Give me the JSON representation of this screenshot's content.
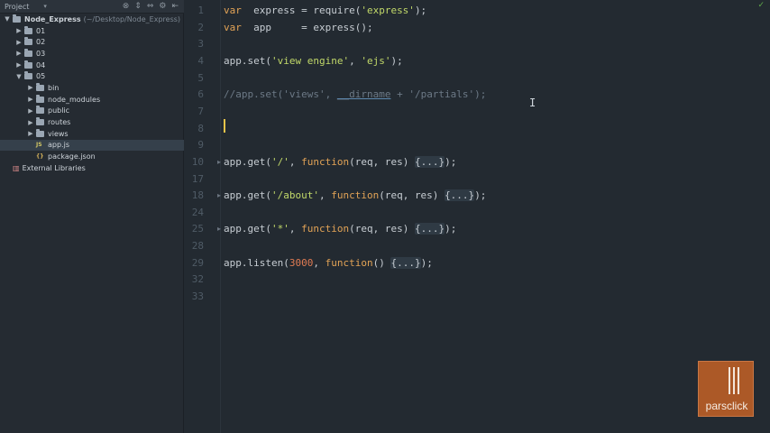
{
  "sidebar": {
    "header": {
      "label": "Project"
    },
    "tree": [
      {
        "label": "Node_Express",
        "hint": "(~/Desktop/Node_Express)",
        "depth": 0,
        "type": "folder",
        "expanded": true
      },
      {
        "label": "01",
        "depth": 1,
        "type": "folder",
        "expanded": false
      },
      {
        "label": "02",
        "depth": 1,
        "type": "folder",
        "expanded": false
      },
      {
        "label": "03",
        "depth": 1,
        "type": "folder",
        "expanded": false
      },
      {
        "label": "04",
        "depth": 1,
        "type": "folder",
        "expanded": false
      },
      {
        "label": "05",
        "depth": 1,
        "type": "folder",
        "expanded": true
      },
      {
        "label": "bin",
        "depth": 2,
        "type": "folder",
        "expanded": false
      },
      {
        "label": "node_modules",
        "depth": 2,
        "type": "folder",
        "expanded": false
      },
      {
        "label": "public",
        "depth": 2,
        "type": "folder",
        "expanded": false
      },
      {
        "label": "routes",
        "depth": 2,
        "type": "folder",
        "expanded": false
      },
      {
        "label": "views",
        "depth": 2,
        "type": "folder",
        "expanded": false
      },
      {
        "label": "app.js",
        "depth": 2,
        "type": "js",
        "selected": true,
        "icon": "JS"
      },
      {
        "label": "package.json",
        "depth": 2,
        "type": "json",
        "icon": "{}"
      },
      {
        "label": "External Libraries",
        "depth": 0,
        "type": "lib"
      }
    ]
  },
  "editor": {
    "lines": [
      {
        "num": "1",
        "tokens": [
          [
            "kw",
            "var"
          ],
          [
            "",
            "  express = require("
          ],
          [
            "str",
            "'express'"
          ],
          [
            "",
            ");"
          ]
        ]
      },
      {
        "num": "2",
        "tokens": [
          [
            "kw",
            "var"
          ],
          [
            "",
            "  app     = express();"
          ]
        ]
      },
      {
        "num": "3",
        "tokens": []
      },
      {
        "num": "4",
        "tokens": [
          [
            "",
            "app.set("
          ],
          [
            "str",
            "'view engine'"
          ],
          [
            "",
            ", "
          ],
          [
            "str",
            "'ejs'"
          ],
          [
            "",
            ");"
          ]
        ]
      },
      {
        "num": "5",
        "tokens": []
      },
      {
        "num": "6",
        "tokens": [
          [
            "cm",
            "//app.set('views', "
          ],
          [
            "cm-u",
            "__dirname"
          ],
          [
            "cm",
            " + '/partials');"
          ]
        ]
      },
      {
        "num": "7",
        "tokens": []
      },
      {
        "num": "8",
        "tokens": []
      },
      {
        "num": "9",
        "tokens": []
      },
      {
        "num": "10",
        "fold": true,
        "tokens": [
          [
            "",
            "app.get("
          ],
          [
            "str",
            "'/'"
          ],
          [
            "",
            ", "
          ],
          [
            "kw",
            "function"
          ],
          [
            "",
            "(req, res) "
          ],
          [
            "fold",
            "{...}"
          ],
          [
            "",
            ");"
          ]
        ]
      },
      {
        "num": "17",
        "tokens": []
      },
      {
        "num": "18",
        "fold": true,
        "tokens": [
          [
            "",
            "app.get("
          ],
          [
            "str",
            "'/about'"
          ],
          [
            "",
            ", "
          ],
          [
            "kw",
            "function"
          ],
          [
            "",
            "(req, res) "
          ],
          [
            "fold",
            "{...}"
          ],
          [
            "",
            ");"
          ]
        ]
      },
      {
        "num": "24",
        "tokens": []
      },
      {
        "num": "25",
        "fold": true,
        "tokens": [
          [
            "",
            "app.get("
          ],
          [
            "str",
            "'*'"
          ],
          [
            "",
            ", "
          ],
          [
            "kw",
            "function"
          ],
          [
            "",
            "(req, res) "
          ],
          [
            "fold",
            "{...}"
          ],
          [
            "",
            ");"
          ]
        ]
      },
      {
        "num": "28",
        "tokens": []
      },
      {
        "num": "29",
        "tokens": [
          [
            "",
            "app.listen("
          ],
          [
            "num",
            "3000"
          ],
          [
            "",
            ", "
          ],
          [
            "kw",
            "function"
          ],
          [
            "",
            "() "
          ],
          [
            "fold",
            "{...}"
          ],
          [
            "",
            ");"
          ]
        ]
      },
      {
        "num": "32",
        "tokens": []
      },
      {
        "num": "33",
        "tokens": []
      }
    ]
  },
  "watermark": {
    "text": "parsclick"
  },
  "colors": {
    "keyword": "#e2a356",
    "string": "#c1d869",
    "number": "#e07b53",
    "comment": "#6c7986",
    "caret": "#e6c44a"
  }
}
